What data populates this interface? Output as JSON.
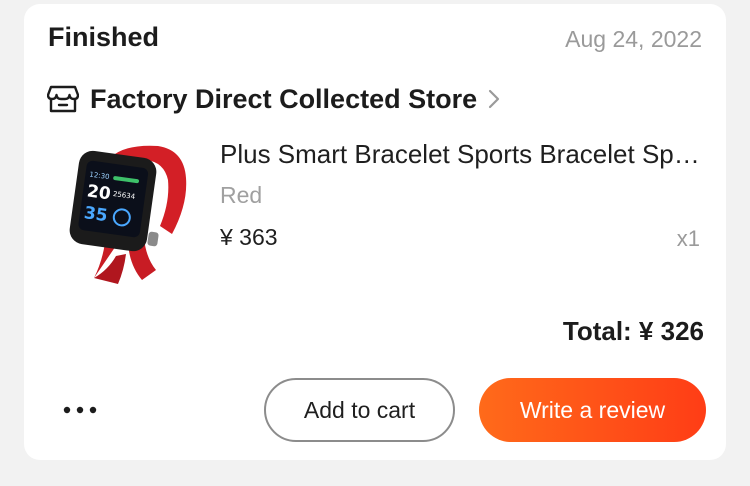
{
  "order": {
    "status": "Finished",
    "date": "Aug 24, 2022"
  },
  "store": {
    "icon": "store-icon",
    "name": "Factory Direct Collected Store",
    "chevron_icon": "chevron-right-icon"
  },
  "item": {
    "title": "Plus Smart Bracelet Sports Bracelet Sports Watch",
    "variant": "Red",
    "price": "¥ 363",
    "quantity": "x1",
    "image_icon": "smartwatch-image",
    "watch_screen": {
      "line1": "20",
      "line2": "35",
      "side1": "25634",
      "top": "12:30"
    }
  },
  "summary": {
    "total": "Total: ¥ 326"
  },
  "actions": {
    "more_icon": "more-icon",
    "add_to_cart_label": "Add to cart",
    "write_review_label": "Write a review"
  },
  "colors": {
    "accent_start": "#ff6a1a",
    "accent_end": "#ff3d16",
    "watch_strap": "#d31f26"
  }
}
